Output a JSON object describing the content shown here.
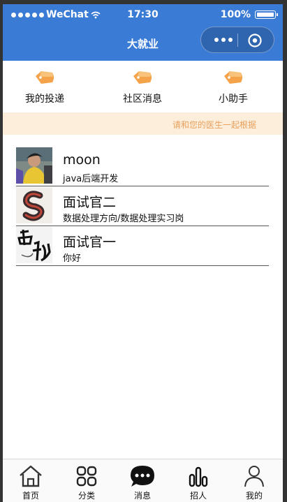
{
  "status_bar": {
    "carrier": "WeChat",
    "time": "17:30",
    "battery": "100%"
  },
  "header": {
    "title": "大就业"
  },
  "quick_nav": [
    {
      "label": "我的投递",
      "icon": "tag-icon"
    },
    {
      "label": "社区消息",
      "icon": "tag-icon"
    },
    {
      "label": "小助手",
      "icon": "tag-icon"
    }
  ],
  "notice": {
    "text": "请和您的医生一起根据"
  },
  "messages": [
    {
      "name": "moon",
      "subtitle": "java后端开发",
      "avatar": "photo-avatar"
    },
    {
      "name": "面试官二",
      "subtitle": "数据处理方向/数据处理实习岗",
      "avatar": "letter-s-avatar"
    },
    {
      "name": "面试官一",
      "subtitle": "你好",
      "avatar": "calligraphy-avatar"
    }
  ],
  "tabbar": [
    {
      "label": "首页",
      "icon": "home-icon"
    },
    {
      "label": "分类",
      "icon": "grid-icon"
    },
    {
      "label": "消息",
      "icon": "chat-bubble-icon"
    },
    {
      "label": "招人",
      "icon": "bar-chart-icon"
    },
    {
      "label": "我的",
      "icon": "user-icon"
    }
  ],
  "colors": {
    "header_bg": "#3a7bd5",
    "notice_bg": "#fdeedb",
    "notice_text": "#e8a05c",
    "tag_orange": "#f5a34a"
  }
}
